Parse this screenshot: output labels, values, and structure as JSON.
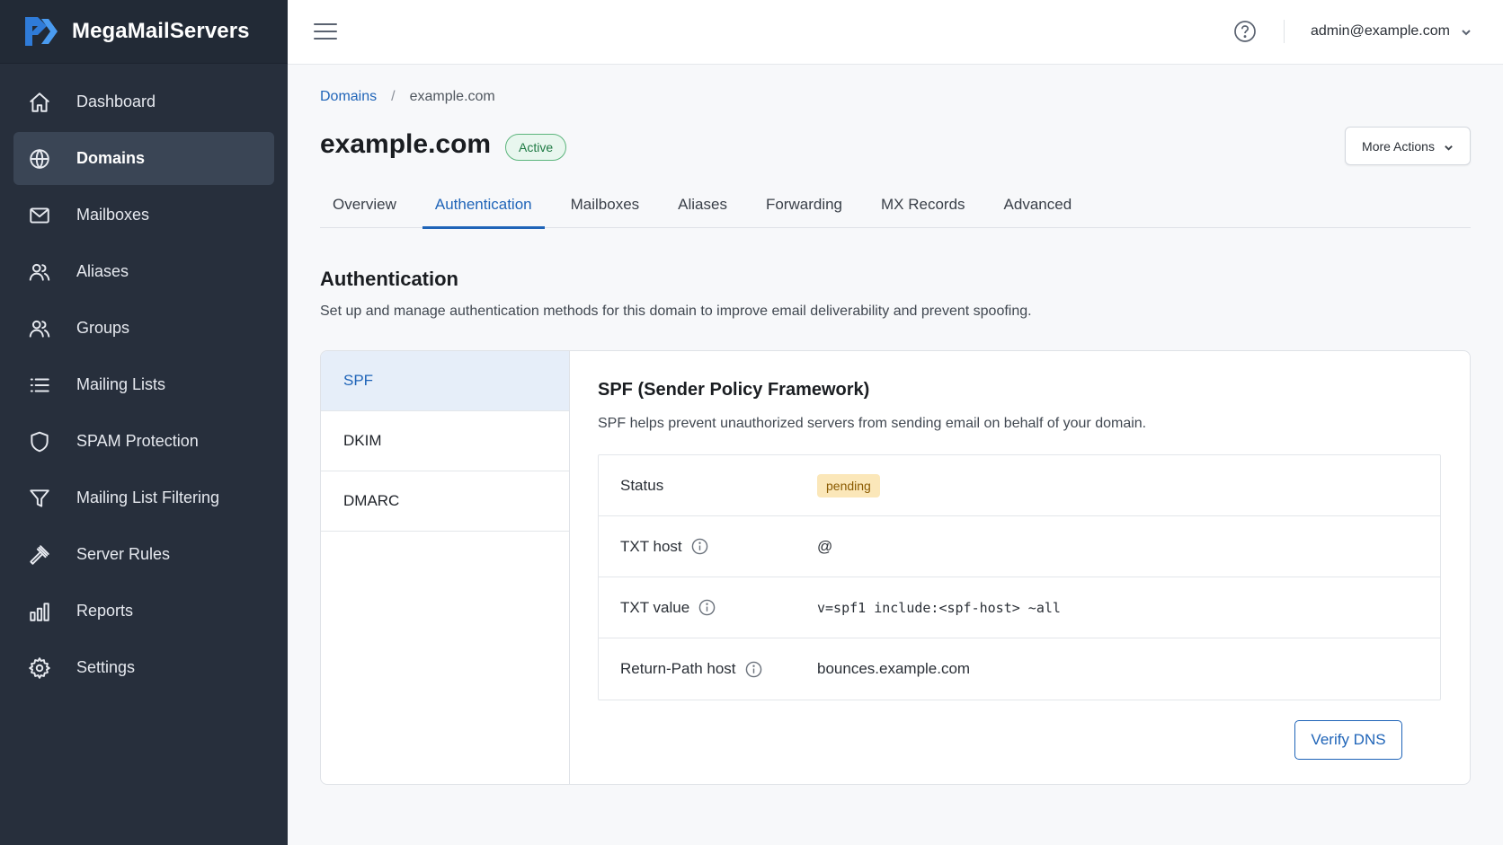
{
  "brand": {
    "name": "MegaMailServers",
    "logo_icon": "brand-logo-icon",
    "accent": "#2f7bd8"
  },
  "sidebar": {
    "items": [
      {
        "label": "Dashboard",
        "icon": "home-icon",
        "active": false
      },
      {
        "label": "Domains",
        "icon": "globe-icon",
        "active": true
      },
      {
        "label": "Mailboxes",
        "icon": "mail-icon",
        "active": false
      },
      {
        "label": "Aliases",
        "icon": "users-icon",
        "active": false
      },
      {
        "label": "Groups",
        "icon": "group-icon",
        "active": false
      },
      {
        "label": "Mailing Lists",
        "icon": "list-icon",
        "active": false
      },
      {
        "label": "SPAM Protection",
        "icon": "shield-icon",
        "active": false
      },
      {
        "label": "Mailing List Filtering",
        "icon": "filter-icon",
        "active": false
      },
      {
        "label": "Server Rules",
        "icon": "gavel-icon",
        "active": false
      },
      {
        "label": "Reports",
        "icon": "bar-chart-icon",
        "active": false
      },
      {
        "label": "Settings",
        "icon": "gear-icon",
        "active": false
      }
    ]
  },
  "topbar": {
    "menu_icon": "hamburger-icon",
    "help_icon": "help-icon",
    "user_email": "admin@example.com"
  },
  "breadcrumb": {
    "parent": "Domains",
    "separator": "/",
    "current": "example.com"
  },
  "page": {
    "title": "example.com",
    "status": "Active",
    "more_actions": "More Actions"
  },
  "tabs": [
    {
      "label": "Overview",
      "active": false
    },
    {
      "label": "Authentication",
      "active": true
    },
    {
      "label": "Mailboxes",
      "active": false
    },
    {
      "label": "Aliases",
      "active": false
    },
    {
      "label": "Forwarding",
      "active": false
    },
    {
      "label": "MX Records",
      "active": false
    },
    {
      "label": "Advanced",
      "active": false
    }
  ],
  "section": {
    "title": "Authentication",
    "description": "Set up and manage authentication methods for this domain to improve email deliverability and prevent spoofing."
  },
  "methods": [
    {
      "label": "SPF",
      "active": true
    },
    {
      "label": "DKIM",
      "active": false
    },
    {
      "label": "DMARC",
      "active": false
    }
  ],
  "detail": {
    "title": "SPF (Sender Policy Framework)",
    "description": "SPF helps prevent unauthorized servers from sending email on behalf of your domain.",
    "rows": {
      "status": {
        "label": "Status",
        "value": "pending"
      },
      "txt_host": {
        "label": "TXT host",
        "value": "@"
      },
      "txt_value": {
        "label": "TXT value",
        "value": "v=spf1 include:<spf-host> ~all"
      },
      "return_path": {
        "label": "Return-Path host",
        "value": "bounces.example.com"
      }
    },
    "verify_button": "Verify DNS"
  },
  "colors": {
    "sidebar_bg": "#272f3c",
    "sidebar_active": "#3a4555",
    "link": "#1f64b8",
    "active_badge_border": "#5cb57c",
    "pending_badge_bg": "#fbe7b9"
  }
}
